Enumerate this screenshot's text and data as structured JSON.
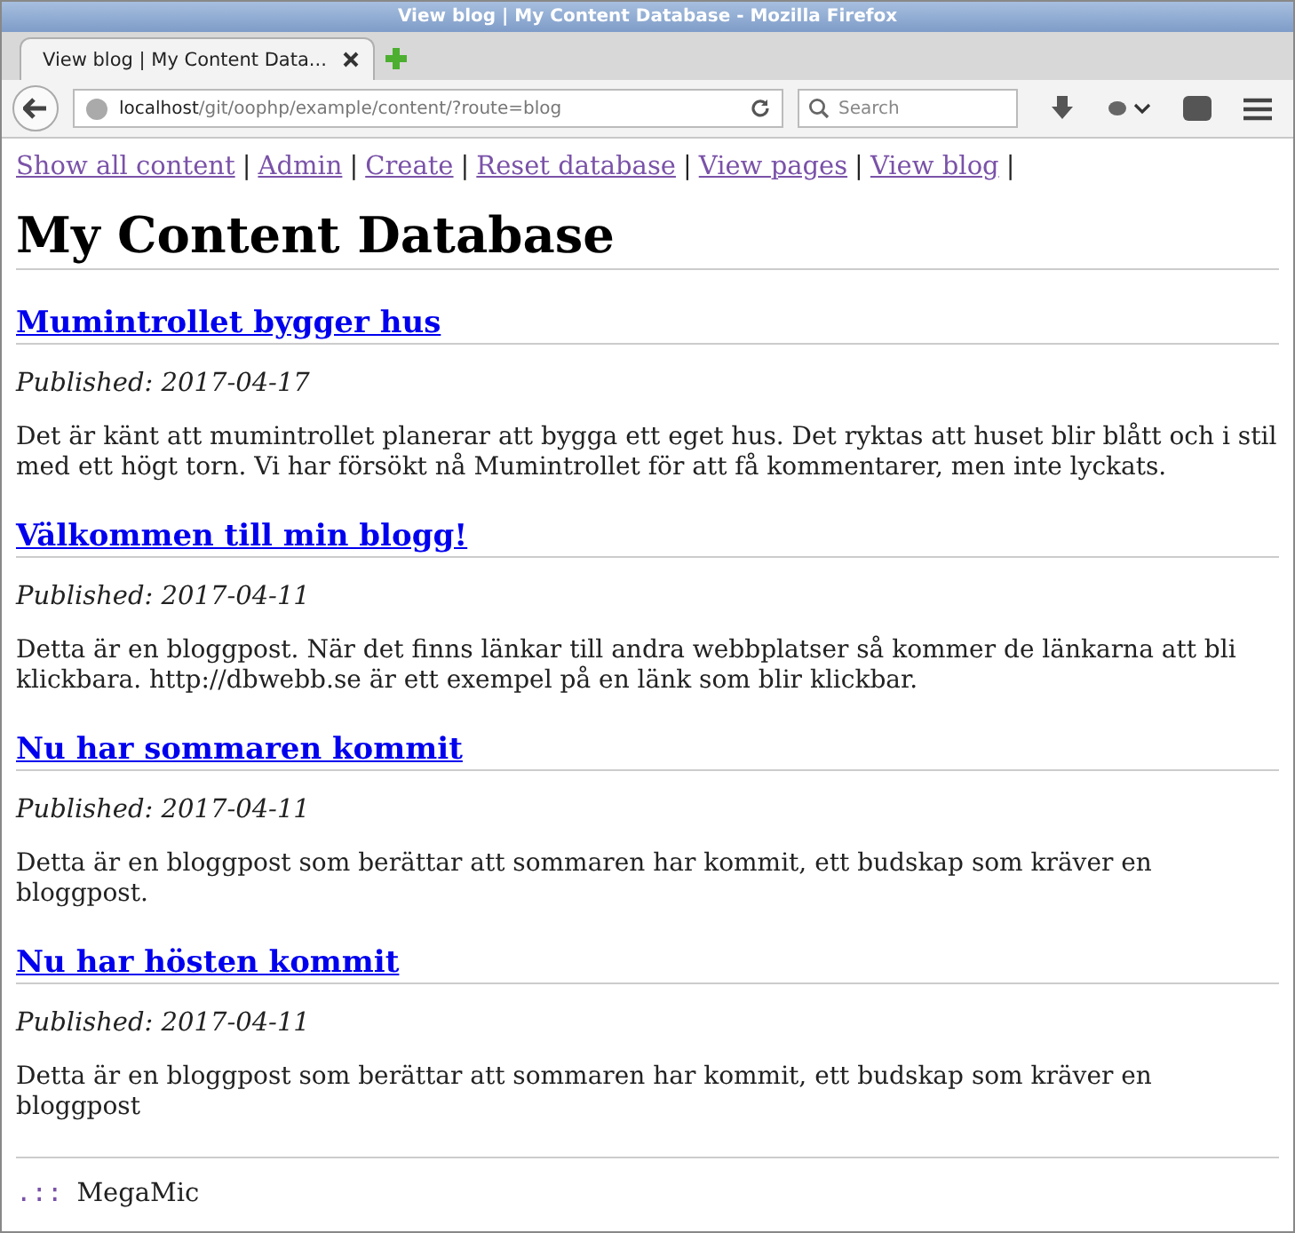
{
  "window": {
    "title": "View blog | My Content Database - Mozilla Firefox"
  },
  "tabs": [
    {
      "label": "View blog | My Content Data...",
      "selected": true
    }
  ],
  "address": {
    "host": "localhost",
    "path": "/git/oophp/example/content/?route=blog"
  },
  "search": {
    "placeholder": "Search"
  },
  "nav_links": [
    {
      "label": "Show all content",
      "separator": "|"
    },
    {
      "label": "Admin",
      "separator": "|"
    },
    {
      "label": "Create",
      "separator": "|"
    },
    {
      "label": "Reset database",
      "separator": "|"
    },
    {
      "label": "View pages",
      "separator": "|"
    },
    {
      "label": "View blog",
      "separator": "|"
    }
  ],
  "heading": "My Content Database",
  "posts": [
    {
      "title": "Mumintrollet bygger hus",
      "published": "Published: 2017-04-17",
      "body": "Det är känt att mumintrollet planerar att bygga ett eget hus. Det ryktas att huset blir blått och i stil med ett högt torn. Vi har försökt nå Mumintrollet för att få kommentarer, men inte lyckats."
    },
    {
      "title": "Välkommen till min blogg!",
      "published": "Published: 2017-04-11",
      "body": "Detta är en bloggpost. När det finns länkar till andra webbplatser så kommer de länkarna att bli klickbara. http://dbwebb.se är ett exempel på en länk som blir klickbar."
    },
    {
      "title": "Nu har sommaren kommit",
      "published": "Published: 2017-04-11",
      "body": "Detta är en bloggpost som berättar att sommaren har kommit, ett budskap som kräver en bloggpost."
    },
    {
      "title": "Nu har hösten kommit",
      "published": "Published: 2017-04-11",
      "body": "Detta är en bloggpost som berättar att sommaren har kommit, ett budskap som kräver en bloggpost"
    }
  ],
  "footer": {
    "mark": ".::",
    "text": "MegaMic"
  }
}
